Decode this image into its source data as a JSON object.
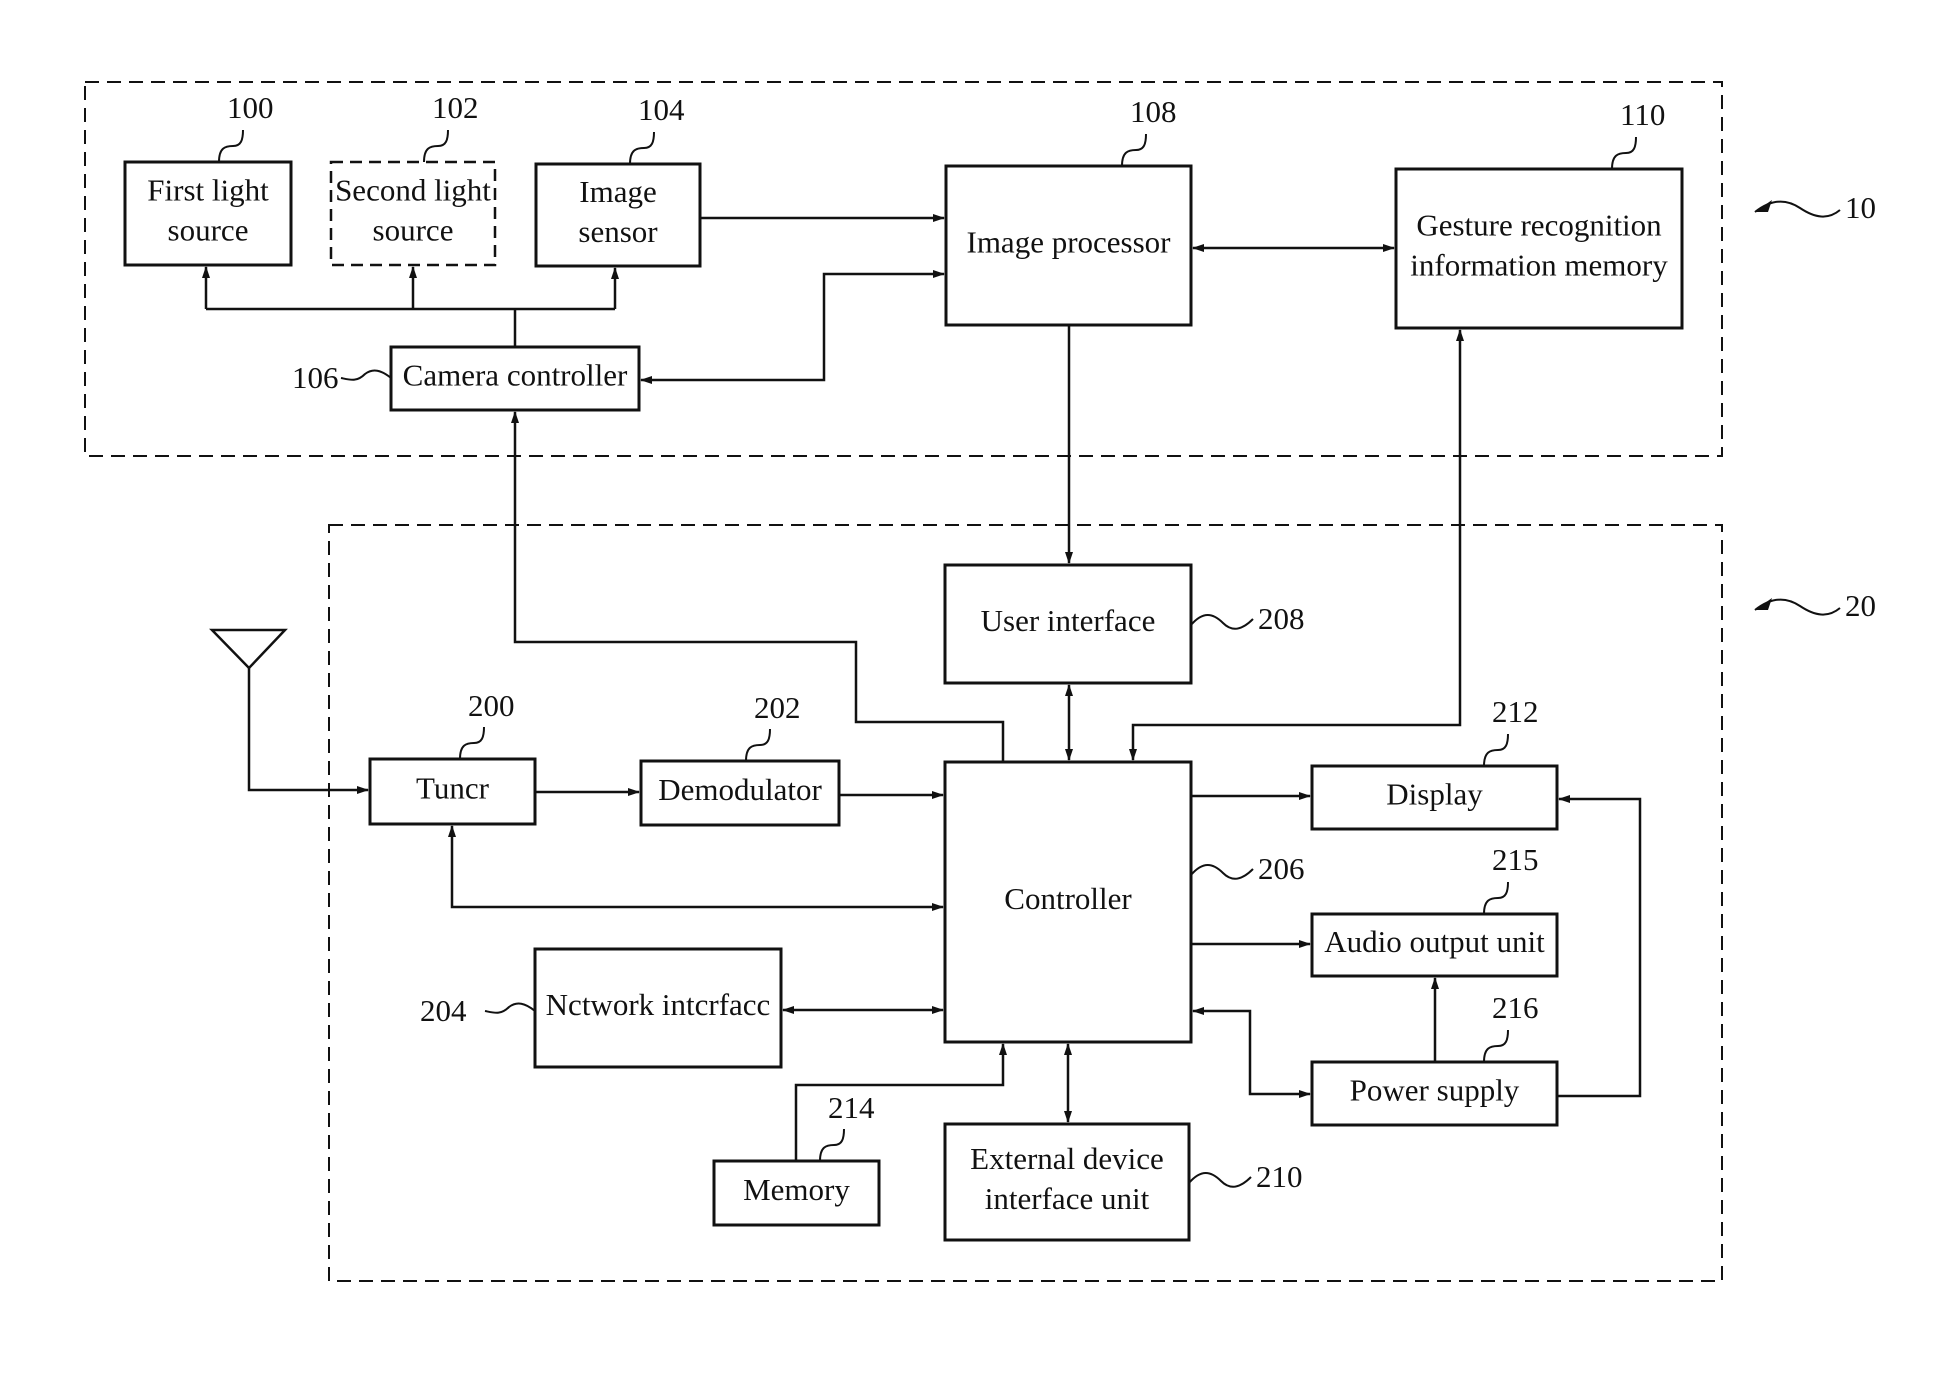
{
  "diagram": {
    "groups": [
      {
        "id": "camera-unit",
        "ref": "10"
      },
      {
        "id": "display-device",
        "ref": "20"
      }
    ],
    "blocks": {
      "first_light": {
        "ref": "100",
        "lines": [
          "First light",
          "source"
        ]
      },
      "second_light": {
        "ref": "102",
        "lines": [
          "Second light",
          "source"
        ],
        "style": "dashed"
      },
      "image_sensor": {
        "ref": "104",
        "lines": [
          "Image",
          "sensor"
        ]
      },
      "camera_controller": {
        "ref": "106",
        "lines": [
          "Camera controller"
        ]
      },
      "image_processor": {
        "ref": "108",
        "lines": [
          "Image processor"
        ]
      },
      "gesture_memory": {
        "ref": "110",
        "lines": [
          "Gesture recognition",
          "information memory"
        ]
      },
      "tuner": {
        "ref": "200",
        "lines": [
          "Tuncr"
        ]
      },
      "demodulator": {
        "ref": "202",
        "lines": [
          "Demodulator"
        ]
      },
      "network_interface": {
        "ref": "204",
        "lines": [
          "Nctwork intcrfacc"
        ]
      },
      "controller": {
        "ref": "206",
        "lines": [
          "Controller"
        ]
      },
      "user_interface": {
        "ref": "208",
        "lines": [
          "User interface"
        ]
      },
      "external_device": {
        "ref": "210",
        "lines": [
          "External device",
          "interface unit"
        ]
      },
      "display": {
        "ref": "212",
        "lines": [
          "Display"
        ]
      },
      "memory": {
        "ref": "214",
        "lines": [
          "Memory"
        ]
      },
      "audio_output": {
        "ref": "215",
        "lines": [
          "Audio output unit"
        ]
      },
      "power_supply": {
        "ref": "216",
        "lines": [
          "Power supply"
        ]
      }
    },
    "connections": [
      {
        "from": "camera_controller",
        "to": "first_light",
        "type": "arrow"
      },
      {
        "from": "camera_controller",
        "to": "second_light",
        "type": "arrow"
      },
      {
        "from": "camera_controller",
        "to": "image_sensor",
        "type": "arrow"
      },
      {
        "from": "image_sensor",
        "to": "image_processor",
        "type": "arrow"
      },
      {
        "from": "camera_controller",
        "to": "image_processor",
        "type": "bidirectional"
      },
      {
        "from": "image_processor",
        "to": "gesture_memory",
        "type": "bidirectional"
      },
      {
        "from": "image_processor",
        "to": "user_interface",
        "type": "arrow"
      },
      {
        "from": "controller",
        "to": "camera_controller",
        "type": "arrow"
      },
      {
        "from": "gesture_memory",
        "to": "controller",
        "type": "bidirectional"
      },
      {
        "from": "user_interface",
        "to": "controller",
        "type": "bidirectional"
      },
      {
        "from": "antenna",
        "to": "tuner",
        "type": "arrow"
      },
      {
        "from": "tuner",
        "to": "demodulator",
        "type": "arrow"
      },
      {
        "from": "demodulator",
        "to": "controller",
        "type": "arrow"
      },
      {
        "from": "controller",
        "to": "tuner",
        "type": "bidirectional"
      },
      {
        "from": "network_interface",
        "to": "controller",
        "type": "bidirectional"
      },
      {
        "from": "memory",
        "to": "controller",
        "type": "arrow"
      },
      {
        "from": "controller",
        "to": "external_device",
        "type": "bidirectional"
      },
      {
        "from": "controller",
        "to": "display",
        "type": "arrow"
      },
      {
        "from": "controller",
        "to": "audio_output",
        "type": "arrow"
      },
      {
        "from": "power_supply",
        "to": "controller",
        "type": "bidirectional"
      },
      {
        "from": "power_supply",
        "to": "audio_output",
        "type": "arrow"
      },
      {
        "from": "power_supply",
        "to": "display",
        "type": "arrow"
      }
    ]
  }
}
